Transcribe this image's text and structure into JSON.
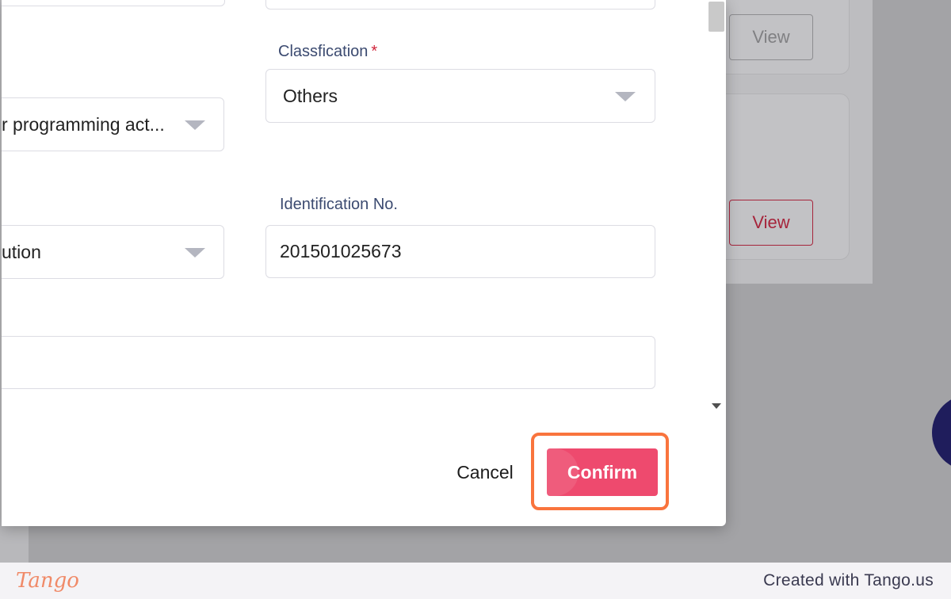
{
  "background": {
    "view_button_1": "View",
    "view_button_2": "View"
  },
  "modal": {
    "classification": {
      "label": "Classfication",
      "required_mark": "*",
      "value": "Others"
    },
    "activity_select": {
      "value": "r programming act..."
    },
    "identification": {
      "label": "Identification No.",
      "value": "201501025673"
    },
    "id_type_select": {
      "value": "ution"
    },
    "text_field": {
      "value": ""
    },
    "cancel_label": "Cancel",
    "confirm_label": "Confirm"
  },
  "footer": {
    "logo": "Tango",
    "credit": "Created with Tango.us"
  },
  "colors": {
    "accent": "#ee4a6e",
    "highlight": "#f9743d",
    "label": "#3b4a70",
    "required": "#d0243a"
  }
}
